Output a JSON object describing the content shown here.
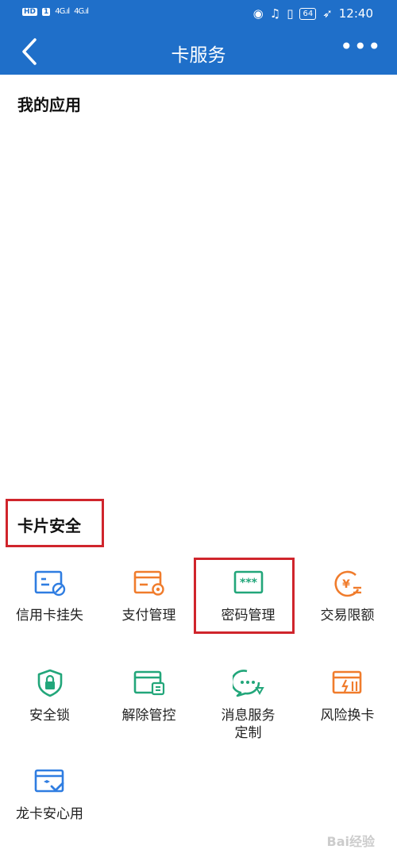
{
  "status_bar": {
    "left": [
      "HD",
      "1",
      "4G",
      "4G"
    ],
    "time": "12:40",
    "battery": "64"
  },
  "nav": {
    "title": "卡服务",
    "more": "•••"
  },
  "sections": {
    "my_apps": "我的应用",
    "card_security": "卡片安全"
  },
  "items": [
    {
      "label": "信用卡挂失",
      "icon": "card-block-icon",
      "color": "#2f7de1"
    },
    {
      "label": "支付管理",
      "icon": "card-gear-icon",
      "color": "#f07c2c"
    },
    {
      "label": "密码管理",
      "icon": "password-icon",
      "color": "#22a67a"
    },
    {
      "label": "交易限额",
      "icon": "yen-limit-icon",
      "color": "#f07c2c"
    },
    {
      "label": "安全锁",
      "icon": "shield-lock-icon",
      "color": "#22a67a"
    },
    {
      "label": "解除管控",
      "icon": "card-release-icon",
      "color": "#22a67a"
    },
    {
      "label": "消息服务\n定制",
      "icon": "message-icon",
      "color": "#22a67a"
    },
    {
      "label": "风险换卡",
      "icon": "card-swap-icon",
      "color": "#f07c2c"
    },
    {
      "label": "龙卡安心用",
      "icon": "card-check-icon",
      "color": "#2f7de1"
    }
  ],
  "watermark": "Bai经验"
}
